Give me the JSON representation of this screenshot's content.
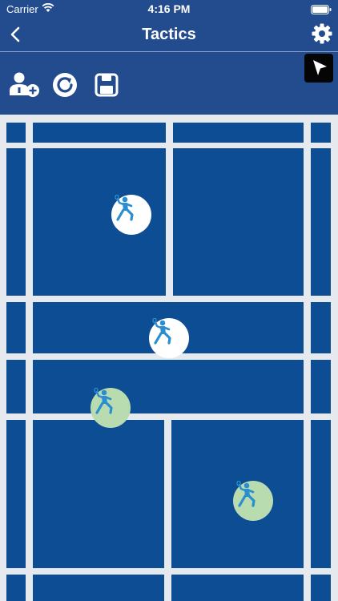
{
  "status_bar": {
    "carrier": "Carrier",
    "time": "4:16 PM"
  },
  "nav": {
    "title": "Tactics"
  },
  "icons": {
    "back": "chevron-left-icon",
    "settings": "gear-icon",
    "add_player": "add-person-icon",
    "reset": "refresh-icon",
    "save": "save-icon",
    "pointer": "cursor-arrow-icon",
    "player": "badminton-player-icon"
  },
  "colors": {
    "header_bg": "#234c8f",
    "court_blue": "#0d4d93",
    "court_lines": "#e6e9ee",
    "team_a_token": "#ffffff",
    "team_b_token": "#b9dbb0",
    "player_figure": "#2a8ed0"
  },
  "players": [
    {
      "team": "a"
    },
    {
      "team": "a"
    },
    {
      "team": "b"
    },
    {
      "team": "b"
    }
  ]
}
